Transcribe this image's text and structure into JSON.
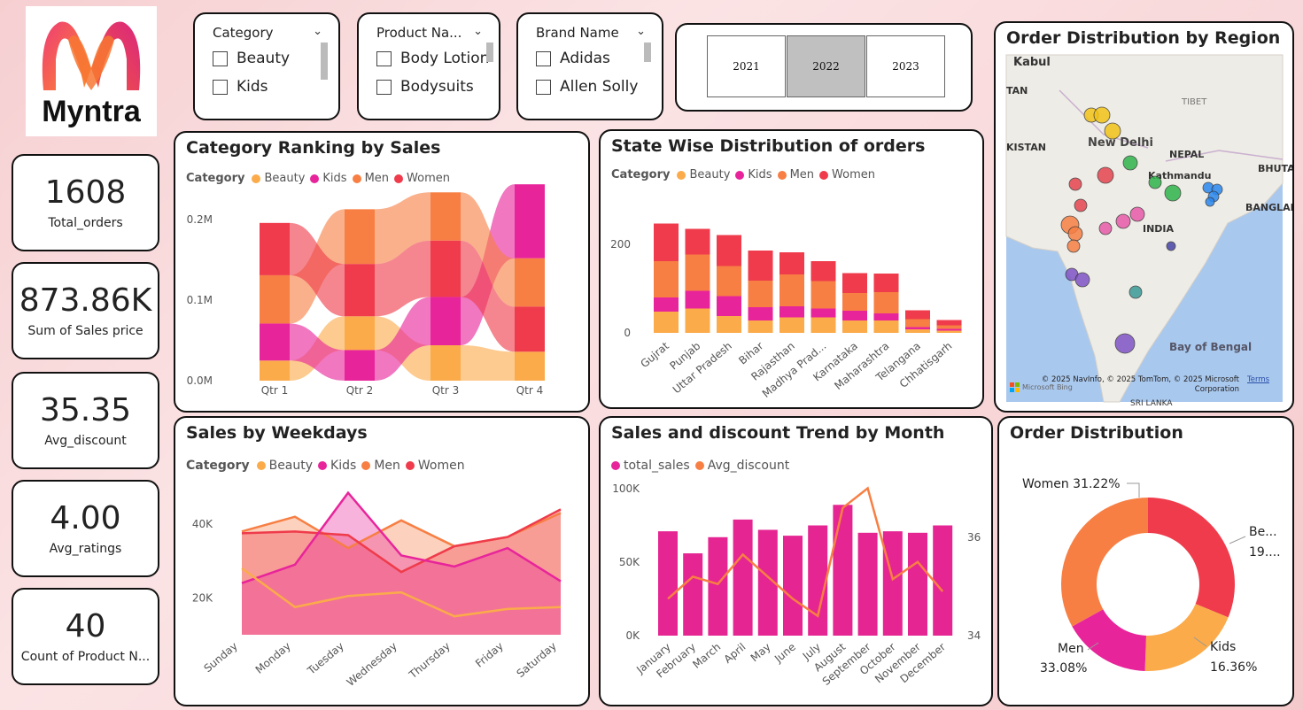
{
  "logo": {
    "text": "Myntra"
  },
  "kpis": [
    {
      "value": "1608",
      "label": "Total_orders"
    },
    {
      "value": "873.86K",
      "label": "Sum of Sales price"
    },
    {
      "value": "35.35",
      "label": "Avg_discount"
    },
    {
      "value": "4.00",
      "label": "Avg_ratings"
    },
    {
      "value": "40",
      "label": "Count of Product N..."
    }
  ],
  "slicers": {
    "category": {
      "title": "Category",
      "options": [
        "Beauty",
        "Kids"
      ]
    },
    "product": {
      "title": "Product Na...",
      "options": [
        "Body Lotion",
        "Bodysuits"
      ]
    },
    "brand": {
      "title": "Brand Name",
      "options": [
        "Adidas",
        "Allen Solly"
      ]
    }
  },
  "years": {
    "items": [
      "2021",
      "2022",
      "2023"
    ],
    "selected": "2022"
  },
  "colors": {
    "beauty": "#fbab4a",
    "kids": "#e8249b",
    "men": "#f77f44",
    "women": "#ef3b4b",
    "accent": "#e52592"
  },
  "category_ranking": {
    "title": "Category Ranking by Sales",
    "legend_title": "Category",
    "legend": [
      "Beauty",
      "Kids",
      "Men",
      "Women"
    ],
    "yticks": [
      "0.0M",
      "0.1M",
      "0.2M"
    ],
    "quarters": [
      "Qtr 1",
      "Qtr 2",
      "Qtr 3",
      "Qtr 4"
    ]
  },
  "state_chart": {
    "title": "State Wise Distribution of orders",
    "legend_title": "Category",
    "legend": [
      "Beauty",
      "Kids",
      "Men",
      "Women"
    ],
    "yticks": [
      "0",
      "200"
    ]
  },
  "weekday_chart": {
    "title": "Sales by Weekdays",
    "legend_title": "Category",
    "legend": [
      "Beauty",
      "Kids",
      "Men",
      "Women"
    ],
    "yticks": [
      "20K",
      "40K"
    ]
  },
  "trend_chart": {
    "title": "Sales and discount Trend by Month",
    "legend": [
      "total_sales",
      "Avg_discount"
    ],
    "yticks_left": [
      "0K",
      "50K",
      "100K"
    ],
    "yticks_right": [
      "34",
      "36"
    ]
  },
  "map": {
    "title": "Order Distribution by Region",
    "labels": {
      "kabul": "Kabul",
      "tan": "TAN",
      "kistan": "KISTAN",
      "tibet": "TIBET",
      "delhi": "New Delhi",
      "nepal": "NEPAL",
      "kathmandu": "Kathmandu",
      "bhuta": "BHUTA",
      "bangla": "BANGLAD",
      "india": "INDIA",
      "bay": "Bay of Bengal",
      "srilanka": "SRI LANKA"
    },
    "copyright": "© 2025 NavInfo, © 2025 TomTom, © 2025 Microsoft Corporation",
    "terms": "Terms",
    "bing": "Microsoft Bing"
  },
  "donut": {
    "title": "Order Distribution",
    "labels": {
      "women": "Women 31.22%",
      "beauty1": "Be...",
      "beauty2": "19....",
      "kids1": "Kids",
      "kids2": "16.36%",
      "men1": "Men",
      "men2": "33.08%"
    }
  },
  "chart_data": [
    {
      "type": "area",
      "title": "Category Ranking by Sales",
      "categories": [
        "Qtr 1",
        "Qtr 2",
        "Qtr 3",
        "Qtr 4"
      ],
      "series": [
        {
          "name": "Beauty",
          "values": [
            0.025,
            0.042,
            0.044,
            0.036
          ]
        },
        {
          "name": "Kids",
          "values": [
            0.046,
            0.038,
            0.06,
            0.092
          ]
        },
        {
          "name": "Men",
          "values": [
            0.06,
            0.068,
            0.06,
            0.06
          ]
        },
        {
          "name": "Women",
          "values": [
            0.065,
            0.065,
            0.07,
            0.056
          ]
        }
      ],
      "ylim": [
        0,
        0.22
      ]
    },
    {
      "type": "bar",
      "title": "State Wise Distribution of orders",
      "categories": [
        "Gujrat",
        "Punjab",
        "Uttar Pradesh",
        "Bihar",
        "Rajasthan",
        "Madhya Prad...",
        "Karnataka",
        "Maharashtra",
        "Telangana",
        "Chhatisgarh"
      ],
      "series": [
        {
          "name": "Beauty",
          "values": [
            48,
            55,
            38,
            28,
            35,
            35,
            28,
            28,
            8,
            5
          ]
        },
        {
          "name": "Kids",
          "values": [
            32,
            40,
            45,
            30,
            25,
            20,
            22,
            16,
            5,
            4
          ]
        },
        {
          "name": "Men",
          "values": [
            82,
            82,
            68,
            60,
            72,
            62,
            40,
            48,
            18,
            8
          ]
        },
        {
          "name": "Women",
          "values": [
            85,
            58,
            70,
            68,
            50,
            45,
            45,
            42,
            20,
            12
          ]
        }
      ],
      "ylim": [
        0,
        260
      ]
    },
    {
      "type": "area",
      "title": "Sales by Weekdays",
      "categories": [
        "Sunday",
        "Monday",
        "Tuesday",
        "Wednesday",
        "Thursday",
        "Friday",
        "Saturday"
      ],
      "series": [
        {
          "name": "Beauty",
          "values": [
            28000,
            17500,
            20500,
            21500,
            15000,
            17000,
            17500
          ]
        },
        {
          "name": "Kids",
          "values": [
            24000,
            29000,
            48500,
            31500,
            28500,
            33500,
            24500
          ]
        },
        {
          "name": "Men",
          "values": [
            38000,
            42000,
            33500,
            41000,
            34000,
            36500,
            43000
          ]
        },
        {
          "name": "Women",
          "values": [
            37500,
            38000,
            37000,
            27000,
            34000,
            36500,
            44000
          ]
        }
      ],
      "ylim": [
        10000,
        52000
      ]
    },
    {
      "type": "bar",
      "title": "Sales and discount Trend by Month",
      "categories": [
        "January",
        "February",
        "March",
        "April",
        "May",
        "June",
        "July",
        "August",
        "September",
        "October",
        "November",
        "December"
      ],
      "series": [
        {
          "name": "total_sales",
          "values": [
            71000,
            56000,
            67000,
            79000,
            72000,
            68000,
            75000,
            89000,
            70000,
            71000,
            70000,
            75000
          ]
        },
        {
          "name": "Avg_discount",
          "values": [
            34.75,
            35.2,
            35.05,
            35.65,
            35.2,
            34.75,
            34.4,
            36.6,
            37.0,
            35.15,
            35.5,
            34.9
          ]
        }
      ],
      "ylim": [
        0,
        100000
      ],
      "y2lim": [
        34,
        37
      ]
    },
    {
      "type": "pie",
      "title": "Order Distribution",
      "categories": [
        "Women",
        "Beauty",
        "Kids",
        "Men"
      ],
      "values": [
        31.22,
        19.34,
        16.36,
        33.08
      ]
    }
  ]
}
